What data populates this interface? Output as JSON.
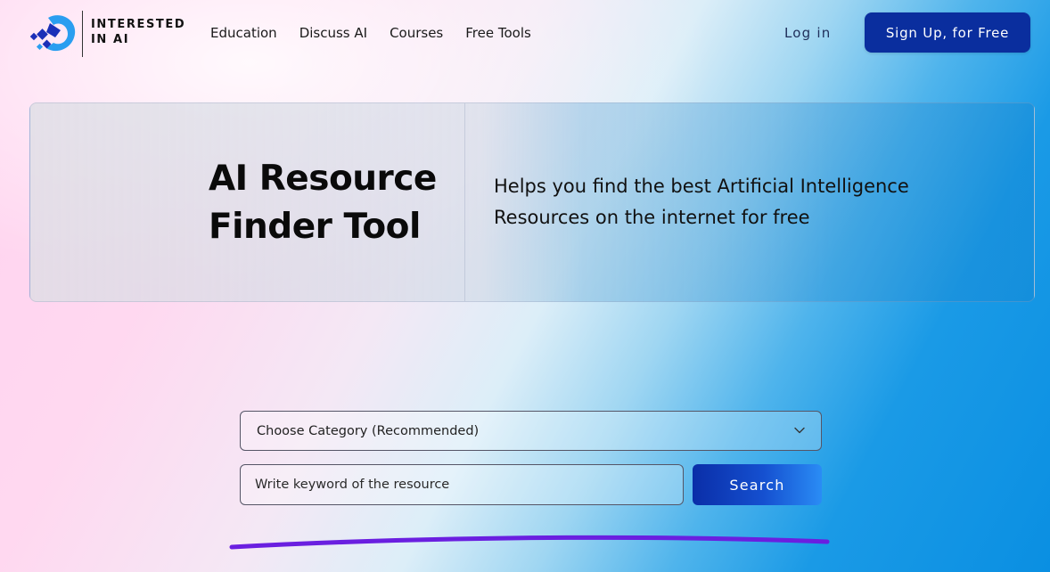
{
  "brand": {
    "name_line1": "INTERESTED",
    "name_line2": "IN AI",
    "logo_icon": "interested-in-ai-logo-icon",
    "colors": {
      "primary": "#0a2e9e",
      "logo_light": "#2a9ef0",
      "logo_dark": "#1b2fb8"
    }
  },
  "nav": {
    "items": [
      {
        "label": "Education"
      },
      {
        "label": "Discuss AI"
      },
      {
        "label": "Courses"
      },
      {
        "label": "Free Tools"
      }
    ],
    "login_label": "Log in",
    "signup_label": "Sign Up, for Free"
  },
  "hero": {
    "title_line1": "AI Resource",
    "title_line2": "Finder Tool",
    "description": "Helps you find the best Artificial Intelligence Resources on the internet for free"
  },
  "search": {
    "category_selected": "Choose Category (Recommended)",
    "category_icon": "chevron-down-icon",
    "keyword_placeholder": "Write keyword of the resource",
    "search_label": "Search",
    "accent_color": "#6a1fe0"
  }
}
